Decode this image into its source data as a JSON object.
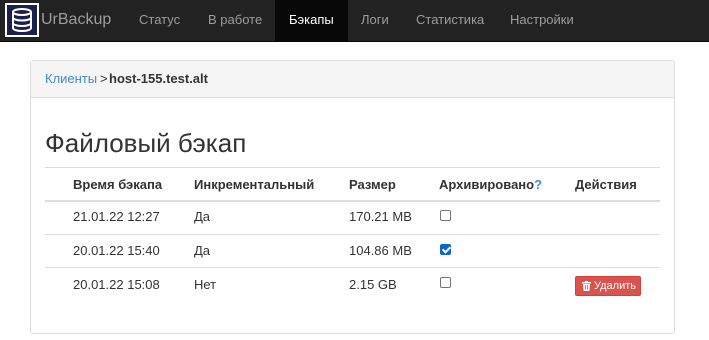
{
  "brand": {
    "name": "UrBackup"
  },
  "nav": {
    "items": [
      {
        "label": "Статус",
        "active": false
      },
      {
        "label": "В работе",
        "active": false
      },
      {
        "label": "Бэкапы",
        "active": true
      },
      {
        "label": "Логи",
        "active": false
      },
      {
        "label": "Статистика",
        "active": false
      },
      {
        "label": "Настройки",
        "active": false
      }
    ]
  },
  "breadcrumb": {
    "link": "Клиенты",
    "separator": ">",
    "current": "host-155.test.alt"
  },
  "page": {
    "title": "Файловый бэкап"
  },
  "table": {
    "headers": {
      "time": "Время бэкапа",
      "incremental": "Инкрементальный",
      "size": "Размер",
      "archived": "Архивировано",
      "archived_help": "?",
      "actions": "Действия"
    },
    "rows": [
      {
        "time": "21.01.22 12:27",
        "incremental": "Да",
        "size": "170.21 MB",
        "archived": false,
        "action": ""
      },
      {
        "time": "20.01.22 15:40",
        "incremental": "Да",
        "size": "104.86 MB",
        "archived": true,
        "action": ""
      },
      {
        "time": "20.01.22 15:08",
        "incremental": "Нет",
        "size": "2.15 GB",
        "archived": false,
        "action": "Удалить"
      }
    ]
  },
  "colors": {
    "navbar_bg": "#222222",
    "link": "#428bca",
    "danger": "#d9534f",
    "checkbox_checked": "#0b66d0"
  }
}
